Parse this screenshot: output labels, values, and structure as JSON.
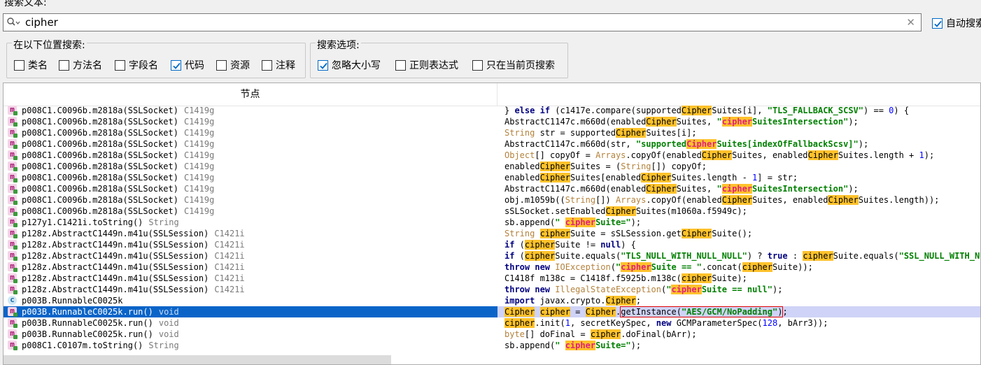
{
  "search": {
    "label": "搜索文本:",
    "value": "cipher",
    "auto_search_label": "自动搜索"
  },
  "location_group": {
    "title": "在以下位置搜索:",
    "options": [
      {
        "label": "类名",
        "checked": false
      },
      {
        "label": "方法名",
        "checked": false
      },
      {
        "label": "字段名",
        "checked": false
      },
      {
        "label": "代码",
        "checked": true
      },
      {
        "label": "资源",
        "checked": false
      },
      {
        "label": "注释",
        "checked": false
      }
    ]
  },
  "options_group": {
    "title": "搜索选项:",
    "options": [
      {
        "label": "忽略大小写",
        "checked": true
      },
      {
        "label": "正则表达式",
        "checked": false
      },
      {
        "label": "只在当前页搜索",
        "checked": false
      }
    ]
  },
  "results": {
    "header": {
      "node": "节点"
    },
    "rows": [
      {
        "node": "p008C1.C0096b.m2818a(SSLSocket)",
        "type": "C1419g",
        "code": "} else if (c1417e.compare(supportedCipherSuites[i], \"TLS_FALLBACK_SCSV\") == 0) {"
      },
      {
        "node": "p008C1.C0096b.m2818a(SSLSocket)",
        "type": "C1419g",
        "code": "AbstractC1147c.m660d(enabledCipherSuites, \"cipherSuitesIntersection\");"
      },
      {
        "node": "p008C1.C0096b.m2818a(SSLSocket)",
        "type": "C1419g",
        "code": "String str = supportedCipherSuites[i];"
      },
      {
        "node": "p008C1.C0096b.m2818a(SSLSocket)",
        "type": "C1419g",
        "code": "AbstractC1147c.m660d(str, \"supportedCipherSuites[indexOfFallbackScsv]\");"
      },
      {
        "node": "p008C1.C0096b.m2818a(SSLSocket)",
        "type": "C1419g",
        "code": "Object[] copyOf = Arrays.copyOf(enabledCipherSuites, enabledCipherSuites.length + 1);"
      },
      {
        "node": "p008C1.C0096b.m2818a(SSLSocket)",
        "type": "C1419g",
        "code": "enabledCipherSuites = (String[]) copyOf;"
      },
      {
        "node": "p008C1.C0096b.m2818a(SSLSocket)",
        "type": "C1419g",
        "code": "enabledCipherSuites[enabledCipherSuites.length - 1] = str;"
      },
      {
        "node": "p008C1.C0096b.m2818a(SSLSocket)",
        "type": "C1419g",
        "code": "AbstractC1147c.m660d(enabledCipherSuites, \"cipherSuitesIntersection\");"
      },
      {
        "node": "p008C1.C0096b.m2818a(SSLSocket)",
        "type": "C1419g",
        "code": "obj.m1059b((String[]) Arrays.copyOf(enabledCipherSuites, enabledCipherSuites.length));"
      },
      {
        "node": "p008C1.C0096b.m2818a(SSLSocket)",
        "type": "C1419g",
        "code": "sSLSocket.setEnabledCipherSuites(m1060a.f5949c);"
      },
      {
        "node": "p127y1.C1421i.toString()",
        "type": "String",
        "code": "sb.append(\" cipherSuite=\");"
      },
      {
        "node": "p128z.AbstractC1449n.m41u(SSLSession)",
        "type": "C1421i",
        "code": "String cipherSuite = sSLSession.getCipherSuite();"
      },
      {
        "node": "p128z.AbstractC1449n.m41u(SSLSession)",
        "type": "C1421i",
        "code": "if (cipherSuite != null) {"
      },
      {
        "node": "p128z.AbstractC1449n.m41u(SSLSession)",
        "type": "C1421i",
        "code": "if (cipherSuite.equals(\"TLS_NULL_WITH_NULL_NULL\") ? true : cipherSuite.equals(\"SSL_NULL_WITH_NULL_"
      },
      {
        "node": "p128z.AbstractC1449n.m41u(SSLSession)",
        "type": "C1421i",
        "code": "throw new IOException(\"cipherSuite == \".concat(cipherSuite));"
      },
      {
        "node": "p128z.AbstractC1449n.m41u(SSLSession)",
        "type": "C1421i",
        "code": "C1418f m138c = C1418f.f5925b.m138c(cipherSuite);"
      },
      {
        "node": "p128z.AbstractC1449n.m41u(SSLSession)",
        "type": "C1421i",
        "code": "throw new IllegalStateException(\"cipherSuite == null\");"
      },
      {
        "node": "p003B.RunnableC0025k",
        "type": "",
        "code": "import javax.crypto.Cipher;"
      },
      {
        "node": "p003B.RunnableC0025k.run()",
        "type": "void",
        "code": "Cipher cipher = Cipher.getInstance(\"AES/GCM/NoPadding\");"
      },
      {
        "node": "p003B.RunnableC0025k.run()",
        "type": "void",
        "code": "cipher.init(1, secretKeySpec, new GCMParameterSpec(128, bArr3));"
      },
      {
        "node": "p003B.RunnableC0025k.run()",
        "type": "void",
        "code": "byte[] doFinal = cipher.doFinal(bArr);"
      },
      {
        "node": "p008C1.C0107m.toString()",
        "type": "String",
        "code": "sb.append(\" cipherSuite=\");"
      }
    ]
  }
}
